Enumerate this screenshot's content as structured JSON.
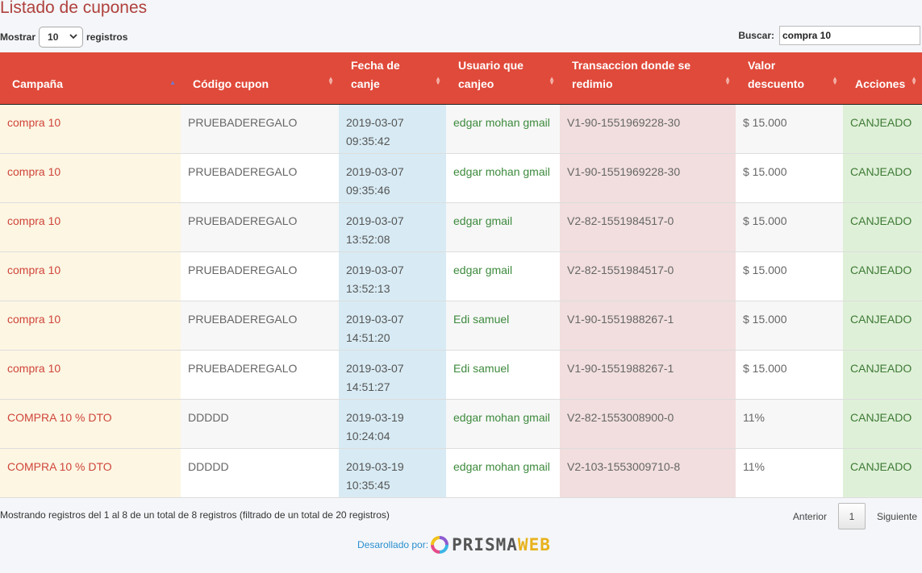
{
  "page": {
    "title": "Listado de cupones"
  },
  "length": {
    "prefix": "Mostrar",
    "value": "10",
    "suffix": "registros"
  },
  "search": {
    "label": "Buscar:",
    "value": "compra 10"
  },
  "columns": [
    {
      "label": "Campaña"
    },
    {
      "label": "Código cupon"
    },
    {
      "label": "Fecha de canje"
    },
    {
      "label": "Usuario que canjeo"
    },
    {
      "label": "Transaccion donde se redimio"
    },
    {
      "label": "Valor descuento"
    },
    {
      "label": "Acciones"
    }
  ],
  "rows": [
    {
      "campana": "compra 10",
      "codigo": "PRUEBADEREGALO",
      "fecha": "2019-03-07 09:35:42",
      "usuario": "edgar mohan gmail",
      "transaccion": "V1-90-1551969228-30",
      "valor": "$ 15.000",
      "accion": "CANJEADO"
    },
    {
      "campana": "compra 10",
      "codigo": "PRUEBADEREGALO",
      "fecha": "2019-03-07 09:35:46",
      "usuario": "edgar mohan gmail",
      "transaccion": "V1-90-1551969228-30",
      "valor": "$ 15.000",
      "accion": "CANJEADO"
    },
    {
      "campana": "compra 10",
      "codigo": "PRUEBADEREGALO",
      "fecha": "2019-03-07 13:52:08",
      "usuario": "edgar gmail",
      "transaccion": "V2-82-1551984517-0",
      "valor": "$ 15.000",
      "accion": "CANJEADO"
    },
    {
      "campana": "compra 10",
      "codigo": "PRUEBADEREGALO",
      "fecha": "2019-03-07 13:52:13",
      "usuario": "edgar gmail",
      "transaccion": "V2-82-1551984517-0",
      "valor": "$ 15.000",
      "accion": "CANJEADO"
    },
    {
      "campana": "compra 10",
      "codigo": "PRUEBADEREGALO",
      "fecha": "2019-03-07 14:51:20",
      "usuario": "Edi samuel",
      "transaccion": "V1-90-1551988267-1",
      "valor": "$ 15.000",
      "accion": "CANJEADO"
    },
    {
      "campana": "compra 10",
      "codigo": "PRUEBADEREGALO",
      "fecha": "2019-03-07 14:51:27",
      "usuario": "Edi samuel",
      "transaccion": "V1-90-1551988267-1",
      "valor": "$ 15.000",
      "accion": "CANJEADO"
    },
    {
      "campana": "COMPRA 10 % DTO",
      "codigo": "DDDDD",
      "fecha": "2019-03-19 10:24:04",
      "usuario": "edgar mohan gmail",
      "transaccion": "V2-82-1553008900-0",
      "valor": "11%",
      "accion": "CANJEADO"
    },
    {
      "campana": "COMPRA 10 % DTO",
      "codigo": "DDDDD",
      "fecha": "2019-03-19 10:35:45",
      "usuario": "edgar mohan gmail",
      "transaccion": "V2-103-1553009710-8",
      "valor": "11%",
      "accion": "CANJEADO"
    }
  ],
  "info": "Mostrando registros del 1 al 8 de un total de 8 registros (filtrado de un total de 20 registros)",
  "pagination": {
    "prev": "Anterior",
    "current": "1",
    "next": "Siguiente"
  },
  "footer": {
    "text": "Desarollado por:",
    "logo_main": "PRISMA",
    "logo_accent": "WEB"
  },
  "colors": {
    "header": "#e04a3a",
    "title": "#b0403c",
    "campaign_col": "#fcf6e3",
    "date_col": "#d8ebf4",
    "transaction_col": "#f2dede",
    "action_col": "#dff0d8"
  },
  "icons": {
    "sort": "sort-arrows-icon",
    "select": "chevron-down-icon",
    "logo": "prismaweb-logo-icon"
  }
}
